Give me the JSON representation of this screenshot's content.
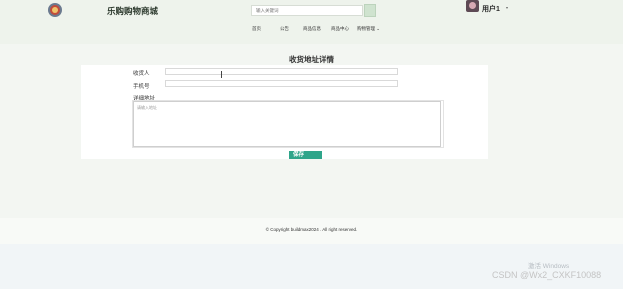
{
  "header": {
    "site_name": "乐购购物商城",
    "search_placeholder": "输入关键词",
    "username": "用户1",
    "caret": "▾"
  },
  "nav": {
    "items": [
      {
        "label": "首页"
      },
      {
        "label": "公告"
      },
      {
        "label": "商品信息"
      },
      {
        "label": "商品中心"
      },
      {
        "label": "购物管理 ⌄"
      }
    ]
  },
  "page": {
    "title": "收货地址详情"
  },
  "form": {
    "recipient_label": "收货人",
    "recipient_value": "",
    "phone_label": "手机号",
    "phone_value": "",
    "address_label": "详细地址",
    "address_placeholder": "请输入地址",
    "save_label": "保存"
  },
  "footer": {
    "copyright": "© Copyright buildmax2024 . All right reserved."
  },
  "overlay": {
    "activate_text": "激活 Windows",
    "watermark": "CSDN @Wx2_CXKF10088"
  }
}
